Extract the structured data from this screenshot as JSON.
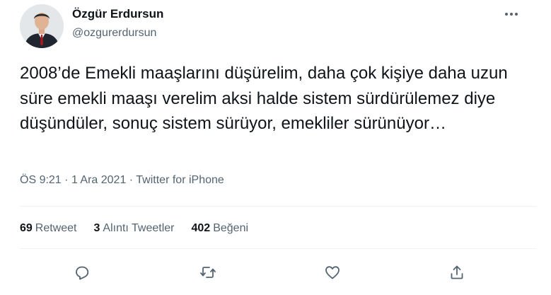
{
  "author": {
    "display_name": "Özgür Erdursun",
    "handle": "@ozgurerdursun"
  },
  "tweet": {
    "text": "2008’de Emekli maaşlarını düşürelim, daha çok kişiye daha uzun süre emekli maaşı verelim aksi halde sistem sürdürülemez diye düşündüler, sonuç sistem sürüyor, emekliler sürünüyor…",
    "time": "ÖS 9:21",
    "date": "1 Ara 2021",
    "source": "Twitter for iPhone",
    "separator": "·"
  },
  "stats": {
    "retweets_count": "69",
    "retweets_label": "Retweet",
    "quotes_count": "3",
    "quotes_label": "Alıntı Tweetler",
    "likes_count": "402",
    "likes_label": "Beğeni"
  },
  "icons": {
    "more": "more-horizontal-icon",
    "reply": "reply-icon",
    "retweet": "retweet-icon",
    "like": "heart-icon",
    "share": "share-icon"
  },
  "colors": {
    "text": "#0f1419",
    "secondary": "#536471",
    "divider": "#eff3f4"
  }
}
